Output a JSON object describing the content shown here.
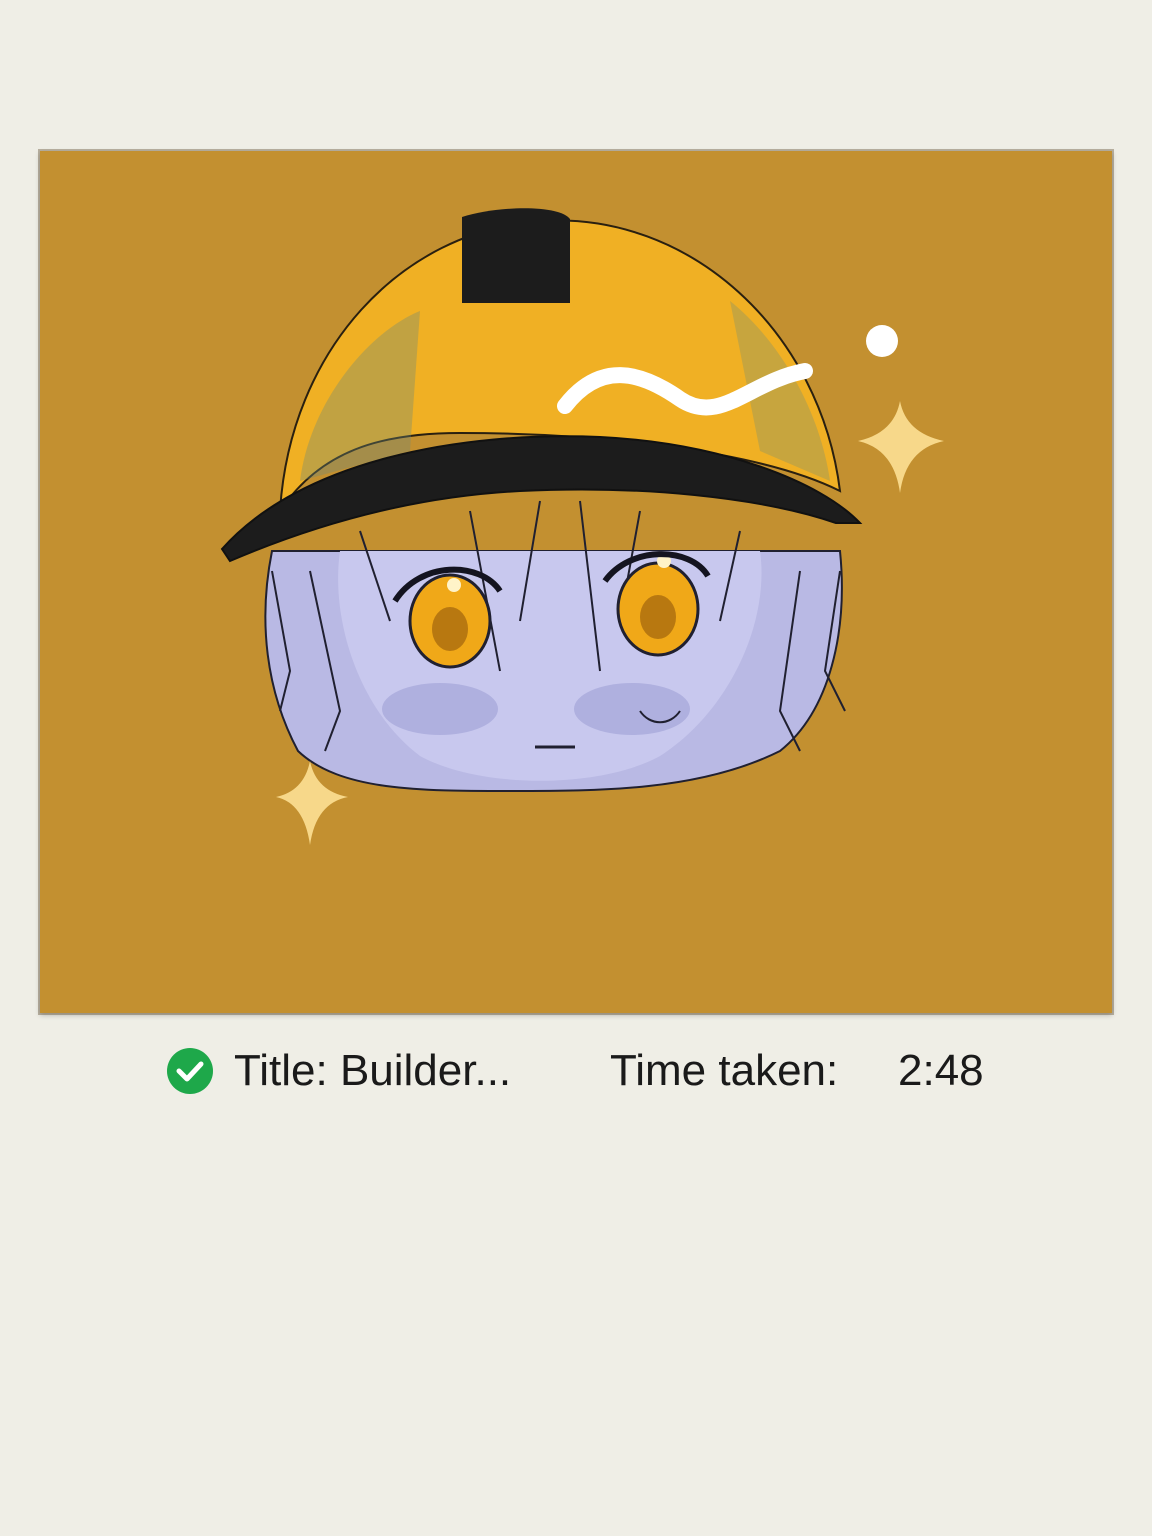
{
  "artwork": {
    "background_color": "#c39030",
    "helmet_color": "#f0b024",
    "hair_color": "#b9b9e4",
    "eye_color": "#f0a818"
  },
  "status": {
    "check_color": "#1ea84a",
    "title_text": "Title: Builder...",
    "time_label": "Time taken:",
    "time_value": "2:48"
  }
}
